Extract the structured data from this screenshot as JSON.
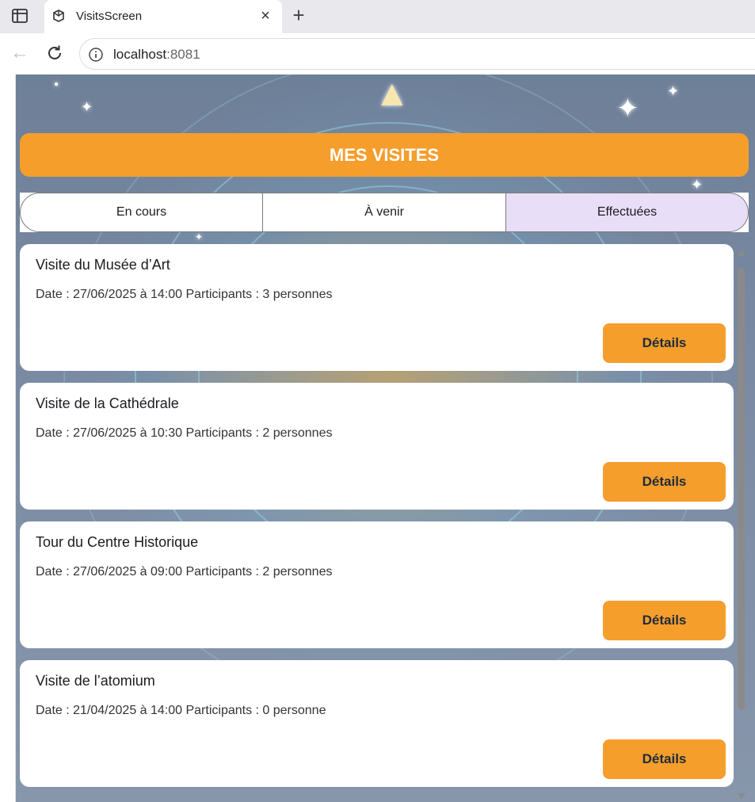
{
  "browser": {
    "tab_title": "VisitsScreen",
    "close_glyph": "×",
    "new_tab_glyph": "+",
    "back_glyph": "←",
    "url_host": "localhost",
    "url_port": ":8081"
  },
  "icons": {
    "sidebar": "sidebar-toggle-icon",
    "favicon": "app-favicon-icon",
    "reload": "reload-icon",
    "info": "site-info-icon"
  },
  "header": {
    "title": "MES VISITES"
  },
  "tabs": [
    {
      "label": "En cours",
      "selected": false
    },
    {
      "label": "À venir",
      "selected": false
    },
    {
      "label": "Effectuées",
      "selected": true
    }
  ],
  "visits": [
    {
      "title": "Visite du Musée d’Art",
      "meta": "Date : 27/06/2025 à 14:00 Participants : 3 personnes",
      "button": "Détails"
    },
    {
      "title": "Visite de la Cathédrale",
      "meta": "Date : 27/06/2025 à 10:30 Participants : 2 personnes",
      "button": "Détails"
    },
    {
      "title": "Tour du Centre Historique",
      "meta": "Date : 27/06/2025 à 09:00 Participants : 2 personnes",
      "button": "Détails"
    },
    {
      "title": "Visite de l’atomium",
      "meta": "Date : 21/04/2025 à 14:00 Participants : 0 personne",
      "button": "Détails"
    }
  ],
  "colors": {
    "accent": "#f59e2c",
    "selected_tab": "#e8def8",
    "button_text": "#1f2b3a"
  }
}
